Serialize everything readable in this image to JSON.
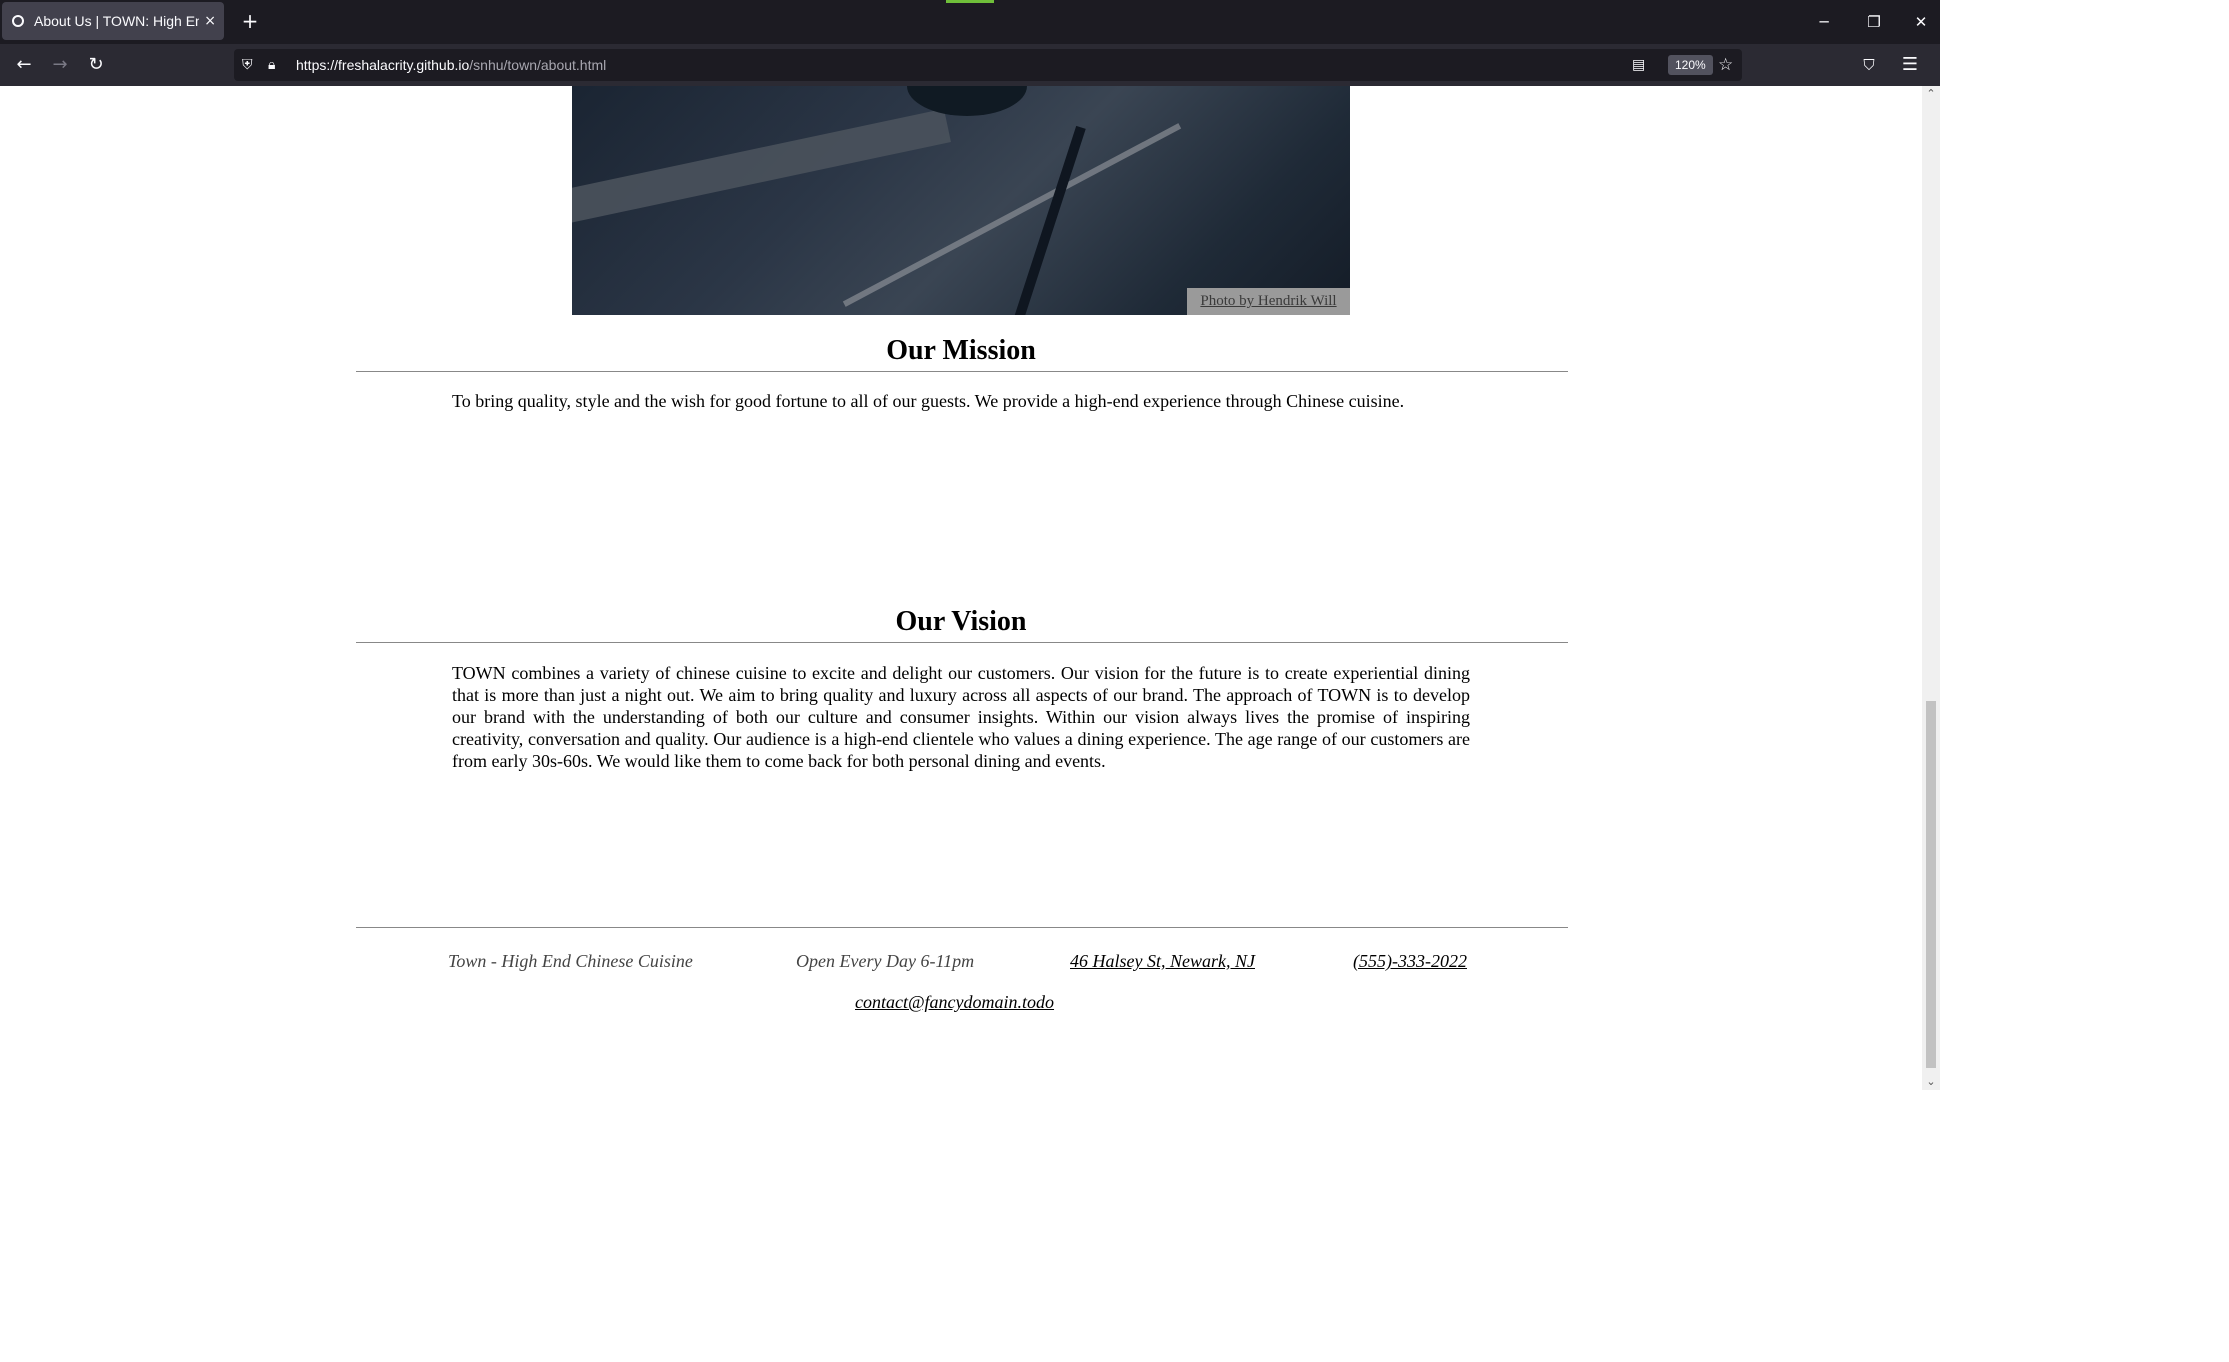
{
  "browser": {
    "tab_title": "About Us | TOWN: High End Chinese Cuisine",
    "tab_close": "×",
    "new_tab": "+",
    "window_buttons": {
      "minimize": "─",
      "restore": "❐",
      "close": "✕"
    },
    "nav": {
      "back": "←",
      "forward": "→",
      "reload": "↻"
    },
    "url_host": "https://freshalacrity.github.io",
    "url_path": "/snhu/town/about.html",
    "zoom": "120%",
    "icons": [
      "shield-icon",
      "lock-icon",
      "reader-view-icon",
      "bookmark-star-icon",
      "pocket-icon",
      "menu-icon"
    ]
  },
  "hero": {
    "caption": "Photo by Hendrik Will"
  },
  "mission": {
    "heading": "Our Mission",
    "text": "To bring quality, style and the wish for good fortune to all of our guests. We provide a high-end experience through Chinese cuisine."
  },
  "vision": {
    "heading": "Our Vision",
    "text": "TOWN combines a variety of chinese cuisine to excite and delight our customers. Our vision for the future is to create experiential dining that is more than just a night out. We aim to bring quality and luxury across all aspects of our brand. The approach of TOWN is to develop our brand with the understanding of both our culture and consumer insights. Within our vision always lives the promise of inspiring creativity, conversation and quality. Our audience is a high-end clientele who values a dining experience. The age range of our customers are from early 30s-60s. We would like them to come back for both personal dining and events."
  },
  "footer": {
    "name": "Town - High End Chinese Cuisine",
    "hours": "Open Every Day 6-11pm",
    "address": "46 Halsey St, Newark, NJ",
    "phone": "(555)-333-2022",
    "email": "contact@fancydomain.todo"
  },
  "colors": {
    "browser_chrome": "#1c1b22",
    "toolbar": "#2b2a33",
    "rule": "#888888",
    "caption_bg": "#9a9a9a"
  }
}
